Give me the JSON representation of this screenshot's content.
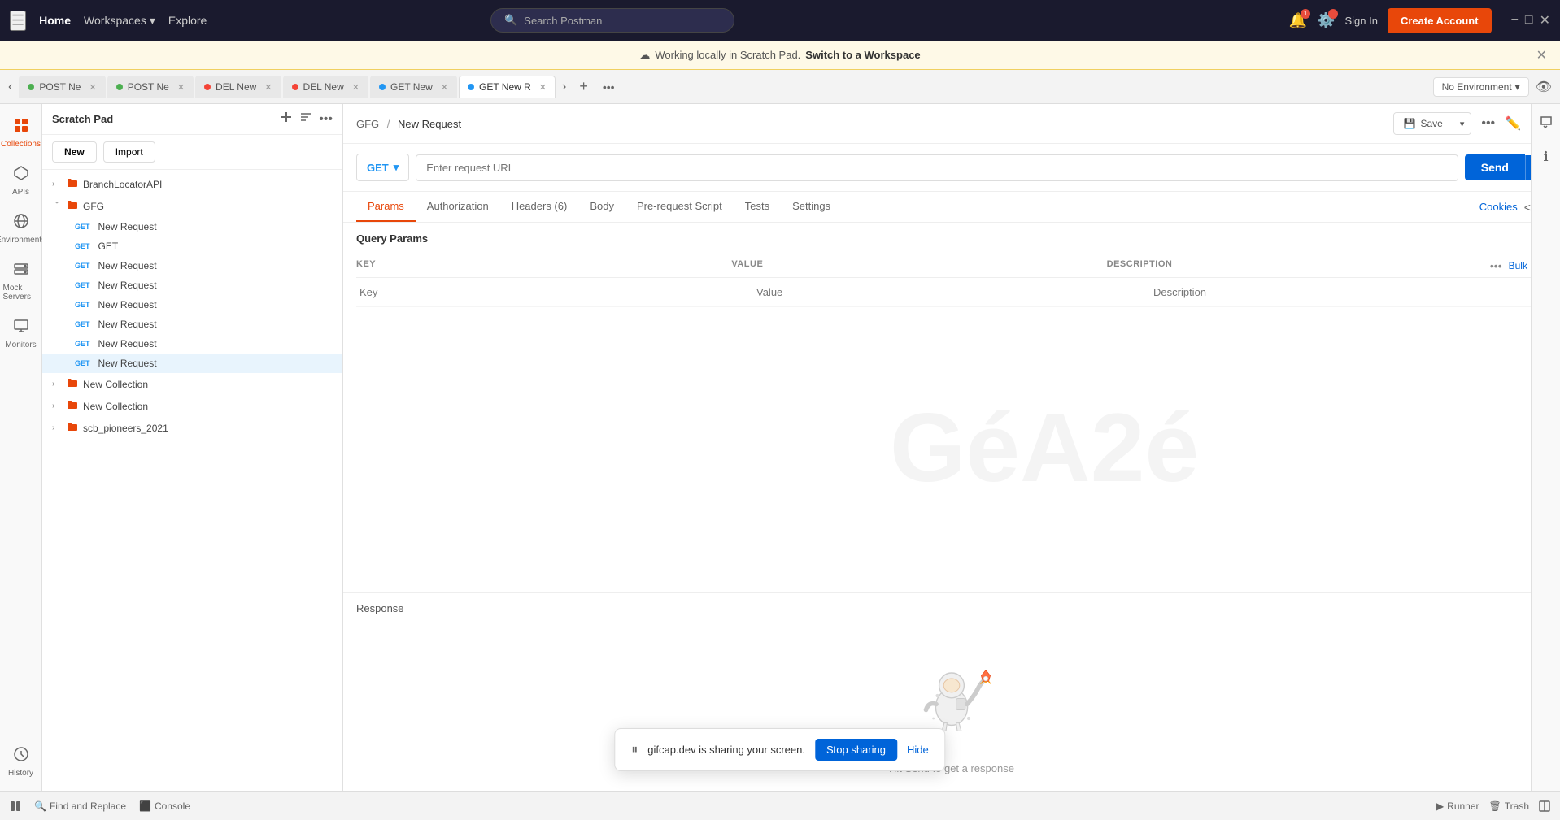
{
  "topnav": {
    "home": "Home",
    "workspaces": "Workspaces",
    "explore": "Explore",
    "search_placeholder": "Search Postman",
    "sign_in": "Sign In",
    "create_account": "Create Account"
  },
  "banner": {
    "text": "Working locally in Scratch Pad.",
    "switch_text": "Switch to a Workspace"
  },
  "tabs": [
    {
      "method": "POST",
      "label": "Ne",
      "color": "#4CAF50",
      "active": false
    },
    {
      "method": "POST",
      "label": "Ne",
      "color": "#4CAF50",
      "active": false
    },
    {
      "method": "DEL",
      "label": "New",
      "color": "#f44336",
      "active": false
    },
    {
      "method": "DEL",
      "label": "New",
      "color": "#f44336",
      "active": false
    },
    {
      "method": "GET",
      "label": "New",
      "color": "#2196F3",
      "active": false
    },
    {
      "method": "GET",
      "label": "New R",
      "color": "#2196F3",
      "active": true
    }
  ],
  "env_selector": "No Environment",
  "sidebar": {
    "title": "Scratch Pad",
    "icons": [
      {
        "id": "collections",
        "label": "Collections",
        "symbol": "⊞"
      },
      {
        "id": "apis",
        "label": "APIs",
        "symbol": "⬡"
      },
      {
        "id": "environments",
        "label": "Environments",
        "symbol": "🌐"
      },
      {
        "id": "mock-servers",
        "label": "Mock Servers",
        "symbol": "⬡"
      },
      {
        "id": "monitors",
        "label": "Monitors",
        "symbol": "📊"
      },
      {
        "id": "history",
        "label": "History",
        "symbol": "⏱"
      }
    ]
  },
  "collections_panel": {
    "title": "Collections",
    "new_btn": "New",
    "import_btn": "Import",
    "tree": [
      {
        "id": "branch-locator",
        "label": "BranchLocatorAPI",
        "expanded": false,
        "indent": 0,
        "type": "collection"
      },
      {
        "id": "gfg",
        "label": "GFG",
        "expanded": true,
        "indent": 0,
        "type": "collection"
      },
      {
        "id": "gfg-new-request",
        "label": "New Request",
        "method": "GET",
        "indent": 1,
        "active": false
      },
      {
        "id": "gfg-get",
        "label": "GET",
        "method": "GET",
        "indent": 1,
        "active": false
      },
      {
        "id": "gfg-new-request-2",
        "label": "New Request",
        "method": "GET",
        "indent": 1,
        "active": false
      },
      {
        "id": "gfg-new-request-3",
        "label": "New Request",
        "method": "GET",
        "indent": 1,
        "active": false
      },
      {
        "id": "gfg-new-request-4",
        "label": "New Request",
        "method": "GET",
        "indent": 1,
        "active": false
      },
      {
        "id": "gfg-new-request-5",
        "label": "New Request",
        "method": "GET",
        "indent": 1,
        "active": false
      },
      {
        "id": "gfg-new-request-6",
        "label": "New Request",
        "method": "GET",
        "indent": 1,
        "active": false
      },
      {
        "id": "gfg-new-request-7",
        "label": "New Request",
        "method": "GET",
        "indent": 1,
        "active": true
      },
      {
        "id": "new-collection-1",
        "label": "New Collection",
        "expanded": false,
        "indent": 0,
        "type": "collection"
      },
      {
        "id": "new-collection-2",
        "label": "New Collection",
        "expanded": false,
        "indent": 0,
        "type": "collection"
      },
      {
        "id": "scb-pioneers",
        "label": "scb_pioneers_2021",
        "expanded": false,
        "indent": 0,
        "type": "collection"
      }
    ]
  },
  "request": {
    "breadcrumb_parent": "GFG",
    "breadcrumb_current": "New Request",
    "method": "GET",
    "url_placeholder": "Enter request URL",
    "send_label": "Send",
    "save_label": "Save",
    "tabs": [
      "Params",
      "Authorization",
      "Headers (6)",
      "Body",
      "Pre-request Script",
      "Tests",
      "Settings"
    ],
    "active_tab": "Params",
    "cookies_label": "Cookies",
    "query_params_title": "Query Params",
    "params_cols": {
      "key": "KEY",
      "value": "VALUE",
      "description": "DESCRIPTION"
    },
    "key_placeholder": "Key",
    "value_placeholder": "Value",
    "description_placeholder": "Description",
    "bulk_edit": "Bulk Edit",
    "response_title": "Response"
  },
  "watermark": "GéA2é",
  "screen_share": {
    "text": "gifcap.dev is sharing your screen.",
    "stop_label": "Stop sharing",
    "hide_label": "Hide"
  },
  "bottombar": {
    "find_replace": "Find and Replace",
    "console": "Console",
    "runner": "Runner",
    "trash": "Trash"
  }
}
